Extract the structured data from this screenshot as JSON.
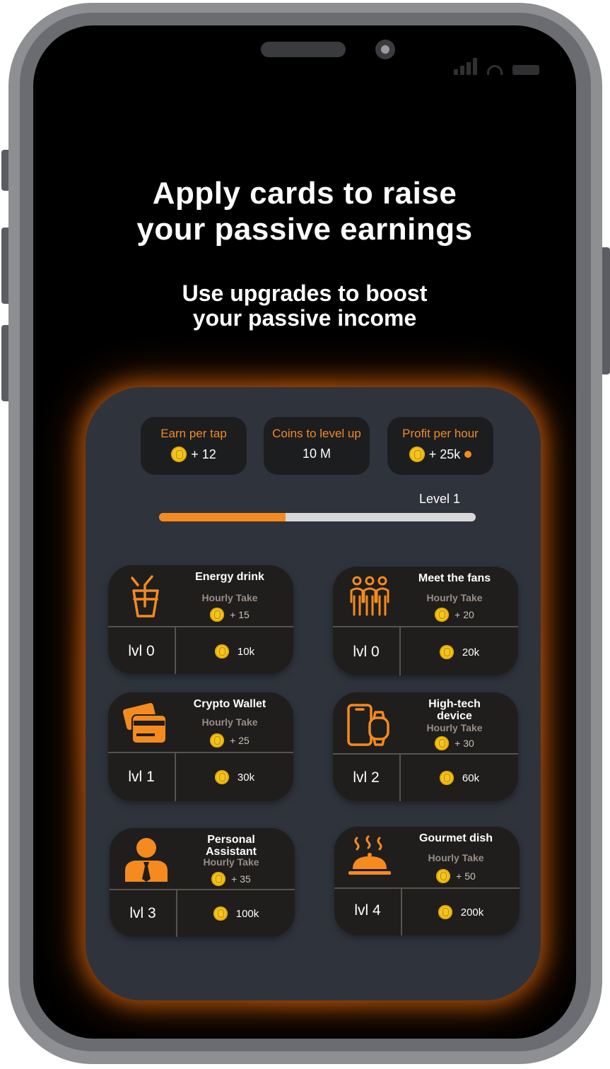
{
  "headline": {
    "line1": "Apply cards to raise",
    "line2": "your passive earnings"
  },
  "subheadline": {
    "line1": "Use upgrades to boost",
    "line2": "your passive income"
  },
  "stats": {
    "earn_per_tap": {
      "label": "Earn per tap",
      "value": "+ 12"
    },
    "coins_to_level_up": {
      "label": "Coins to level up",
      "value": "10 M"
    },
    "profit_per_hour": {
      "label": "Profit per hour",
      "value": "+ 25k"
    }
  },
  "level": {
    "label": "Level 1",
    "progress": 0.4
  },
  "cards": [
    {
      "title1": "Energy drink",
      "title2": "",
      "hourly": "Hourly Take",
      "take": "+ 15",
      "level": "lvl 0",
      "cost": "10k",
      "icon": "energy-drink-icon"
    },
    {
      "title1": "Meet the fans",
      "title2": "",
      "hourly": "Hourly Take",
      "take": "+ 20",
      "level": "lvl 0",
      "cost": "20k",
      "icon": "fans-icon"
    },
    {
      "title1": "Crypto Wallet",
      "title2": "",
      "hourly": "Hourly Take",
      "take": "+ 25",
      "level": "lvl 1",
      "cost": "30k",
      "icon": "wallet-icon"
    },
    {
      "title1": "High-tech",
      "title2": "device",
      "hourly": "Hourly Take",
      "take": "+ 30",
      "level": "lvl 2",
      "cost": "60k",
      "icon": "device-icon"
    },
    {
      "title1": "Personal",
      "title2": "Assistant",
      "hourly": "Hourly Take",
      "take": "+ 35",
      "level": "lvl 3",
      "cost": "100k",
      "icon": "assistant-icon"
    },
    {
      "title1": "Gourmet dish",
      "title2": "",
      "hourly": "Hourly Take",
      "take": "+ 50",
      "level": "lvl 4",
      "cost": "200k",
      "icon": "gourmet-dish-icon"
    }
  ],
  "colors": {
    "accent": "#f58a1f",
    "panel": "#2f333c",
    "card": "#1f1e1c",
    "coin": "#f5c518"
  }
}
